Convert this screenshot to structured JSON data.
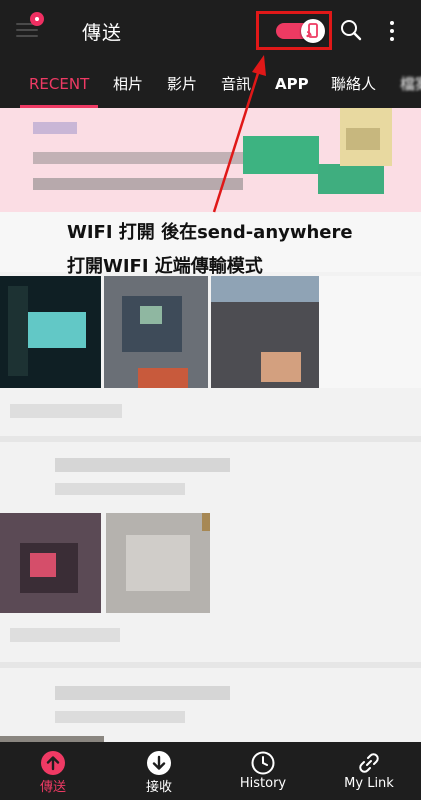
{
  "app": {
    "title": "傳送",
    "accent_color": "#ef3a64",
    "nearby_toggle": {
      "state": "on",
      "icon": "phone-cast-icon"
    }
  },
  "icons": {
    "menu": "hamburger-menu-icon",
    "search": "search-icon",
    "more": "more-vert-icon"
  },
  "tabs": [
    {
      "label": "RECENT",
      "active": true
    },
    {
      "label": "相片"
    },
    {
      "label": "影片"
    },
    {
      "label": "音訊"
    },
    {
      "label": "APP"
    },
    {
      "label": "聯絡人"
    },
    {
      "label": "檔案"
    }
  ],
  "annotation": {
    "line1": "WIFI 打開 後在send-anywhere",
    "line2": "打開WIFI 近端傳輸模式",
    "highlight_color": "#e01818"
  },
  "bottom_nav": [
    {
      "label": "傳送",
      "icon": "upload-circle-icon",
      "active": true
    },
    {
      "label": "接收",
      "icon": "download-circle-icon"
    },
    {
      "label": "History",
      "icon": "clock-icon"
    },
    {
      "label": "My Link",
      "icon": "link-icon"
    }
  ]
}
